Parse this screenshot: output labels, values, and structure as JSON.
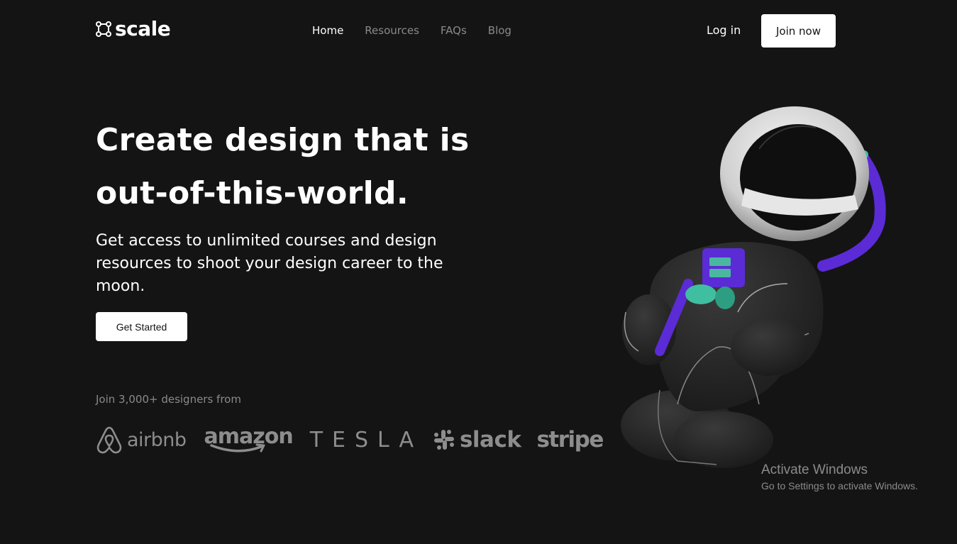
{
  "header": {
    "logo_text": "scale",
    "nav": [
      {
        "label": "Home",
        "active": true
      },
      {
        "label": "Resources",
        "active": false
      },
      {
        "label": "FAQs",
        "active": false
      },
      {
        "label": "Blog",
        "active": false
      }
    ],
    "login_label": "Log in",
    "join_label": "Join now"
  },
  "hero": {
    "title_line1": "Create design that is",
    "title_line2": "out-of-this-world.",
    "subtitle": "Get access to unlimited courses and design resources to shoot your design career to the moon.",
    "cta_label": "Get Started",
    "social_proof": "Join 3,000+ designers from",
    "brands": [
      "airbnb",
      "amazon",
      "TESLA",
      "slack",
      "stripe"
    ]
  },
  "illustration": {
    "icon": "astronaut-illustration",
    "colors": {
      "suit": "#2a2a2a",
      "accent_purple": "#5b2bd6",
      "accent_teal": "#3fbf9f",
      "visor": "#e6e6e6"
    }
  },
  "watermark": {
    "title": "Activate Windows",
    "subtitle": "Go to Settings to activate Windows."
  },
  "colors": {
    "background": "#141414",
    "text_primary": "#ffffff",
    "text_muted": "#8a8a8a",
    "button_bg": "#ffffff",
    "button_text": "#141414"
  }
}
